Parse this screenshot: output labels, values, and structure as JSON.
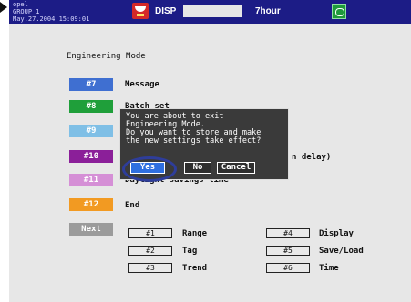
{
  "status": {
    "info_lines": "opel\nGROUP 1\nMay.27.2004 15:09:01",
    "disp_label": "DISP",
    "period_label": "7hour"
  },
  "mode_title": "Engineering Mode",
  "menu": [
    {
      "code": "#7",
      "label": "Message",
      "color": "#3f6fd1"
    },
    {
      "code": "#8",
      "label": "Batch set",
      "color": "#1f9f3a"
    },
    {
      "code": "#9",
      "label": "",
      "color": "#7fbfe6"
    },
    {
      "code": "#10",
      "label": "n delay)",
      "color": "#8b1f99"
    },
    {
      "code": "#11",
      "label": "Daylight savings time",
      "color": "#d58fd6"
    },
    {
      "code": "#12",
      "label": "End",
      "color": "#f29a22"
    }
  ],
  "next_label": "Next",
  "next_color": "#9b9b9b",
  "tabs_left": [
    {
      "code": "#1",
      "label": "Range"
    },
    {
      "code": "#2",
      "label": "Tag"
    },
    {
      "code": "#3",
      "label": "Trend"
    }
  ],
  "tabs_right": [
    {
      "code": "#4",
      "label": "Display"
    },
    {
      "code": "#5",
      "label": "Save/Load"
    },
    {
      "code": "#6",
      "label": "Time"
    }
  ],
  "dialog": {
    "message": "You are about to exit\nEngineering Mode.\nDo you want to store and make\nthe new settings take effect?",
    "yes": "Yes",
    "no": "No",
    "cancel": "Cancel"
  }
}
